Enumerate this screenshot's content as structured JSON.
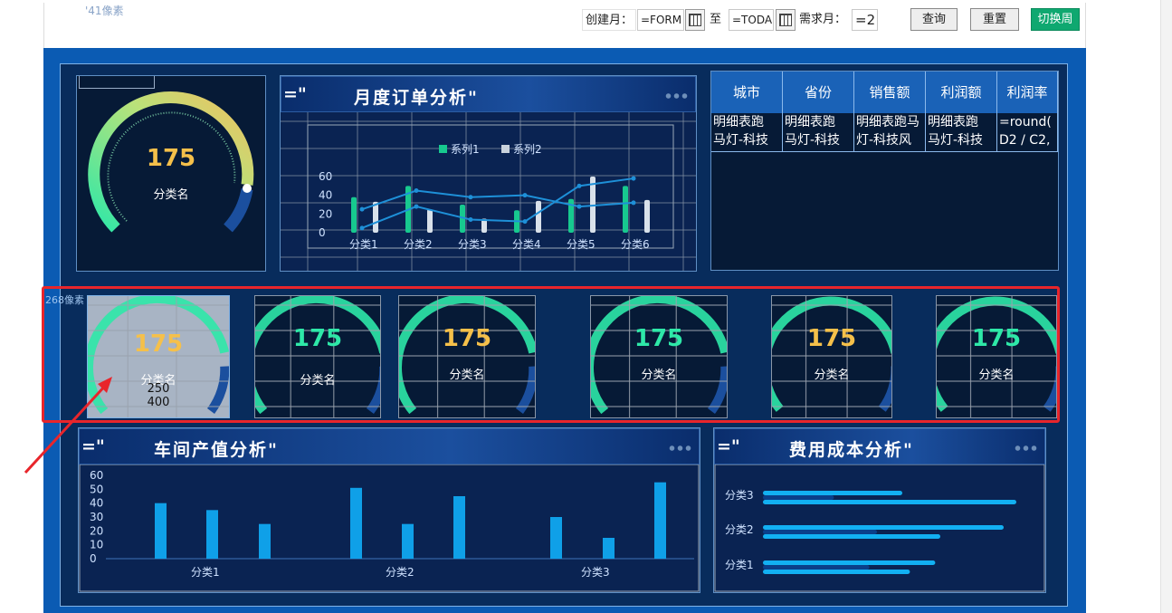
{
  "toolbar": {
    "pixel_note": "'41像素",
    "create_month_label": "创建月：",
    "create_from": "=FORM",
    "to_label": "至",
    "create_to": "=TODA",
    "demand_month_label": "需求月：",
    "demand_value": "=2",
    "query_button": "查询",
    "reset_button": "重置",
    "switch_button": "切换周"
  },
  "gauge_main": {
    "value": "175",
    "category": "分类名"
  },
  "monthly_orders": {
    "prefix": "=\"",
    "title": "月度订单分析\"",
    "legend": [
      "系列1",
      "系列2"
    ],
    "chart_data": {
      "type": "bar",
      "categories": [
        "分类1",
        "分类2",
        "分类3",
        "分类4",
        "分类5",
        "分类6"
      ],
      "series": [
        {
          "name": "系列1",
          "values": [
            38,
            50,
            30,
            24,
            36,
            50
          ]
        },
        {
          "name": "系列2",
          "values": [
            33,
            25,
            15,
            34,
            60,
            35
          ]
        }
      ],
      "lines": [
        {
          "values": [
            25,
            45,
            38,
            40,
            28,
            32
          ]
        },
        {
          "values": [
            5,
            28,
            14,
            12,
            50,
            58
          ]
        }
      ],
      "yticks": [
        "0",
        "20",
        "40",
        "60"
      ],
      "ylim": [
        0,
        70
      ]
    }
  },
  "city_table": {
    "headers": [
      "城市",
      "省份",
      "销售额",
      "利润额",
      "利润率"
    ],
    "row1": [
      "明细表跑",
      "明细表跑",
      "明细表跑马",
      "明细表跑",
      "=round("
    ],
    "row2": [
      "马灯-科技",
      "马灯-科技",
      "灯-科技风",
      "马灯-科技",
      "D2 / C2,"
    ]
  },
  "cards_note": "268像素",
  "cards": [
    {
      "value": "175",
      "category": "分类名",
      "extra1": "250",
      "extra2": "400",
      "color": "#f5c04a"
    },
    {
      "value": "175",
      "category": "分类名",
      "color": "#2ee8a8"
    },
    {
      "value": "175",
      "category": "分类名",
      "color": "#f5c04a"
    },
    {
      "value": "175",
      "category": "分类名",
      "color": "#2ee8a8"
    },
    {
      "value": "175",
      "category": "分类名",
      "color": "#f5c04a"
    },
    {
      "value": "175",
      "category": "分类名",
      "color": "#2ee8a8"
    }
  ],
  "workshop": {
    "prefix": "=\"",
    "title": "车间产值分析\"",
    "chart_data": {
      "type": "bar",
      "categories": [
        "分类1",
        "分类2",
        "分类3"
      ],
      "yticks": [
        "0",
        "10",
        "20",
        "30",
        "40",
        "50",
        "60"
      ],
      "ylim": [
        0,
        60
      ],
      "values": [
        40,
        35,
        25,
        51,
        25,
        45,
        30,
        15,
        55
      ]
    }
  },
  "cost": {
    "prefix": "=\"",
    "title": "费用成本分析\"",
    "chart_data": {
      "type": "bar",
      "orientation": "horizontal",
      "categories": [
        "分类3",
        "分类2",
        "分类1"
      ],
      "series": [
        {
          "values": [
            55,
            95,
            68
          ]
        },
        {
          "values": [
            28,
            45,
            42
          ]
        },
        {
          "values": [
            100,
            70,
            58
          ]
        }
      ],
      "xlim": [
        0,
        100
      ]
    }
  },
  "colors": {
    "bg": "#0b5bb3",
    "panel": "#061a36",
    "accent_green": "#2ee8a8",
    "accent_yellow": "#f5c04a",
    "highlight_red": "#e8252b"
  }
}
